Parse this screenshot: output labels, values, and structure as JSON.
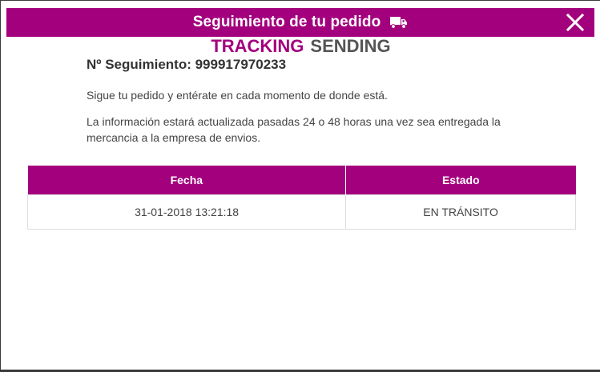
{
  "dialog": {
    "title": "Seguimiento de tu pedido",
    "title_icon": "truck-icon",
    "close_icon": "close-icon"
  },
  "brand": {
    "primary": "TRACKING",
    "secondary": "SENDING"
  },
  "tracking": {
    "number_label": "Nº Seguimiento: 999917970233"
  },
  "content": {
    "intro": "Sigue tu pedido y entérate en cada momento de donde está.",
    "info": "La información estará actualizada pasadas 24 o 48 horas una vez sea entregada la mercancia a la empresa de envios."
  },
  "table": {
    "headers": [
      "Fecha",
      "Estado"
    ],
    "rows": [
      [
        "31-01-2018 13:21:18",
        "EN TRÁNSITO"
      ]
    ]
  },
  "colors": {
    "accent": "#a3007e",
    "secondary_text": "#555555"
  }
}
